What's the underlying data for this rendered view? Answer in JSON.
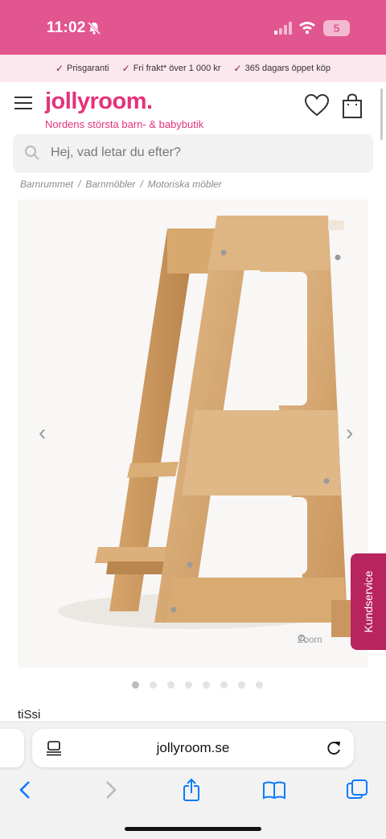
{
  "status": {
    "time": "11:02",
    "battery": "5"
  },
  "promo": {
    "items": [
      "Prisgaranti",
      "Fri frakt* över 1 000 kr",
      "365 dagars öppet köp"
    ]
  },
  "header": {
    "logo": "jollyroom.",
    "tagline": "Nordens största barn- & babybutik"
  },
  "search": {
    "placeholder": "Hej, vad letar du efter?"
  },
  "breadcrumb": [
    "Barnrummet",
    "Barnmöbler",
    "Motoriska möbler"
  ],
  "gallery": {
    "image_logo": "tiSsi",
    "zoom_label": "Zoom",
    "dots_count": 8,
    "active_dot": 0
  },
  "kundservice": "Kundservice",
  "product": {
    "brand": "tiSsi"
  },
  "browser": {
    "url": "jollyroom.se"
  },
  "colors": {
    "brand_pink": "#e4337a",
    "status_bar": "#e2568f",
    "promo_bg": "#fde7ef",
    "kundservice": "#b8245d",
    "ios_blue": "#0a7aff"
  },
  "icons": {
    "menu": "hamburger-icon",
    "wishlist": "heart-icon",
    "cart": "shopping-bag-icon",
    "search": "search-icon",
    "back": "chevron-left-icon",
    "forward": "chevron-right-icon",
    "share": "share-icon",
    "bookmarks": "book-icon",
    "tabs": "tabs-icon"
  }
}
